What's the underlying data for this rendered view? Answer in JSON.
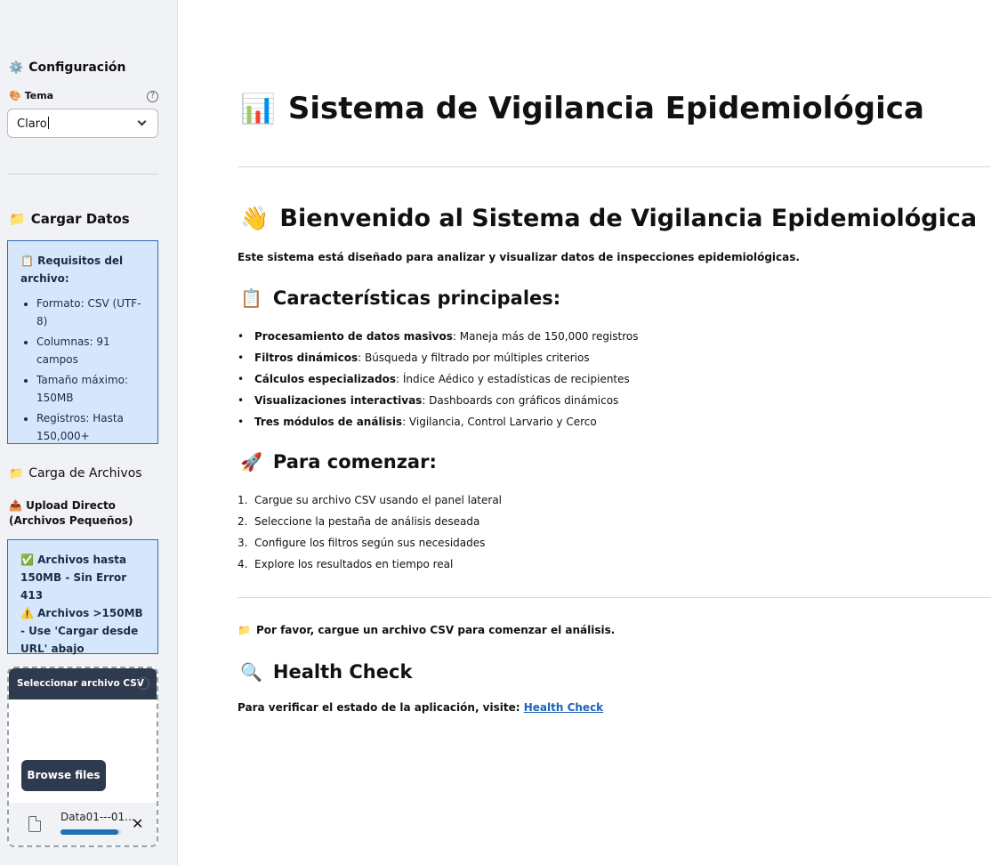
{
  "sidebar": {
    "config_title": "Configuración",
    "config_icon": "⚙️",
    "theme": {
      "label": "Tema",
      "icon": "🎨",
      "value": "Claro"
    },
    "cargar_datos": {
      "title": "Cargar Datos",
      "icon": "📁"
    },
    "requirements": {
      "icon": "📋",
      "title": "Requisitos del archivo:",
      "items": [
        "Formato: CSV (UTF-8)",
        "Columnas: 91 campos",
        "Tamaño máximo: 150MB",
        "Registros: Hasta 150,000+"
      ]
    },
    "carga_archivos": {
      "title": "Carga de Archivos",
      "icon": "📁"
    },
    "upload_direct": {
      "title": "Upload Directo (Archivos Pequeños)",
      "icon": "📤"
    },
    "upload_info": {
      "line1_icon": "✅",
      "line1": "Archivos hasta 150MB - Sin Error 413",
      "line2_icon": "⚠️",
      "line2": "Archivos >150MB - Use 'Cargar desde URL' abajo"
    },
    "uploader": {
      "label": "Seleccionar archivo CSV",
      "browse_label": "Browse files",
      "file_name": "Data01---01...",
      "progress": 0.95
    }
  },
  "main": {
    "title_icon": "📊",
    "title": "Sistema de Vigilancia Epidemiológica",
    "welcome_icon": "👋",
    "welcome": "Bienvenido al Sistema de Vigilancia Epidemiológica",
    "intro": "Este sistema está diseñado para analizar y visualizar datos de inspecciones epidemiológicas.",
    "features_icon": "📋",
    "features_title": "Características principales:",
    "features": [
      {
        "bold": "Procesamiento de datos masivos",
        "text": ": Maneja más de 150,000 registros"
      },
      {
        "bold": "Filtros dinámicos",
        "text": ": Búsqueda y filtrado por múltiples criterios"
      },
      {
        "bold": "Cálculos especializados",
        "text": ": Índice Aédico y estadísticas de recipientes"
      },
      {
        "bold": "Visualizaciones interactivas",
        "text": ": Dashboards con gráficos dinámicos"
      },
      {
        "bold": "Tres módulos de análisis",
        "text": ": Vigilancia, Control Larvario y Cerco"
      }
    ],
    "start_icon": "🚀",
    "start_title": "Para comenzar:",
    "steps": [
      "Cargue su archivo CSV usando el panel lateral",
      "Seleccione la pestaña de análisis deseada",
      "Configure los filtros según sus necesidades",
      "Explore los resultados en tiempo real"
    ],
    "notice_icon": "📁",
    "notice": "Por favor, cargue un archivo CSV para comenzar el análisis.",
    "health_icon": "🔍",
    "health_title": "Health Check",
    "health_text": "Para verificar el estado de la aplicación, visite: ",
    "health_link": "Health Check"
  }
}
